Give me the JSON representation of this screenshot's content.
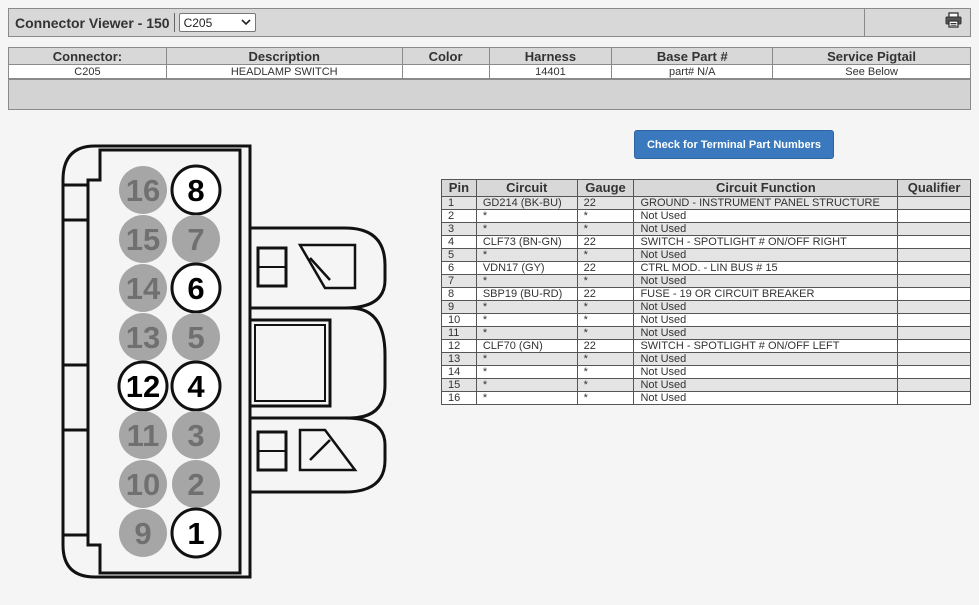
{
  "header": {
    "title": "Connector Viewer - 150",
    "connector_select": "C205"
  },
  "info": {
    "columns": [
      "Connector:",
      "Description",
      "Color",
      "Harness",
      "Base Part #",
      "Service Pigtail"
    ],
    "values": [
      "C205",
      "HEADLAMP SWITCH",
      "",
      "14401",
      "part# N/A",
      "See Below"
    ]
  },
  "button": {
    "label": "Check for Terminal Part Numbers"
  },
  "pin_table": {
    "columns": [
      "Pin",
      "Circuit",
      "Gauge",
      "Circuit Function",
      "Qualifier"
    ],
    "rows": [
      {
        "pin": "1",
        "circuit": "GD214 (BK-BU)",
        "gauge": "22",
        "function": "GROUND - INSTRUMENT PANEL STRUCTURE",
        "qualifier": ""
      },
      {
        "pin": "2",
        "circuit": "*",
        "gauge": "*",
        "function": "Not Used",
        "qualifier": ""
      },
      {
        "pin": "3",
        "circuit": "*",
        "gauge": "*",
        "function": "Not Used",
        "qualifier": ""
      },
      {
        "pin": "4",
        "circuit": "CLF73 (BN-GN)",
        "gauge": "22",
        "function": "SWITCH - SPOTLIGHT # ON/OFF RIGHT",
        "qualifier": ""
      },
      {
        "pin": "5",
        "circuit": "*",
        "gauge": "*",
        "function": "Not Used",
        "qualifier": ""
      },
      {
        "pin": "6",
        "circuit": "VDN17 (GY)",
        "gauge": "22",
        "function": "CTRL MOD. - LIN BUS # 15",
        "qualifier": ""
      },
      {
        "pin": "7",
        "circuit": "*",
        "gauge": "*",
        "function": "Not Used",
        "qualifier": ""
      },
      {
        "pin": "8",
        "circuit": "SBP19 (BU-RD)",
        "gauge": "22",
        "function": "FUSE - 19 OR CIRCUIT BREAKER",
        "qualifier": ""
      },
      {
        "pin": "9",
        "circuit": "*",
        "gauge": "*",
        "function": "Not Used",
        "qualifier": ""
      },
      {
        "pin": "10",
        "circuit": "*",
        "gauge": "*",
        "function": "Not Used",
        "qualifier": ""
      },
      {
        "pin": "11",
        "circuit": "*",
        "gauge": "*",
        "function": "Not Used",
        "qualifier": ""
      },
      {
        "pin": "12",
        "circuit": "CLF70 (GN)",
        "gauge": "22",
        "function": "SWITCH - SPOTLIGHT # ON/OFF LEFT",
        "qualifier": ""
      },
      {
        "pin": "13",
        "circuit": "*",
        "gauge": "*",
        "function": "Not Used",
        "qualifier": ""
      },
      {
        "pin": "14",
        "circuit": "*",
        "gauge": "*",
        "function": "Not Used",
        "qualifier": ""
      },
      {
        "pin": "15",
        "circuit": "*",
        "gauge": "*",
        "function": "Not Used",
        "qualifier": ""
      },
      {
        "pin": "16",
        "circuit": "*",
        "gauge": "*",
        "function": "Not Used",
        "qualifier": ""
      }
    ]
  },
  "connector": {
    "pins": [
      {
        "label": "16",
        "used": false
      },
      {
        "label": "8",
        "used": true
      },
      {
        "label": "15",
        "used": false
      },
      {
        "label": "7",
        "used": false
      },
      {
        "label": "14",
        "used": false
      },
      {
        "label": "6",
        "used": true
      },
      {
        "label": "13",
        "used": false
      },
      {
        "label": "5",
        "used": false
      },
      {
        "label": "12",
        "used": true
      },
      {
        "label": "4",
        "used": true
      },
      {
        "label": "11",
        "used": false
      },
      {
        "label": "3",
        "used": false
      },
      {
        "label": "10",
        "used": false
      },
      {
        "label": "2",
        "used": false
      },
      {
        "label": "9",
        "used": false
      },
      {
        "label": "1",
        "used": true
      }
    ]
  },
  "icons": {
    "print": "printer-icon",
    "dropdown": "chevron-down-icon"
  },
  "colors": {
    "button": "#3a79bd",
    "unused_pin": "#a6a6a6",
    "used_pin": "#ffffff"
  }
}
